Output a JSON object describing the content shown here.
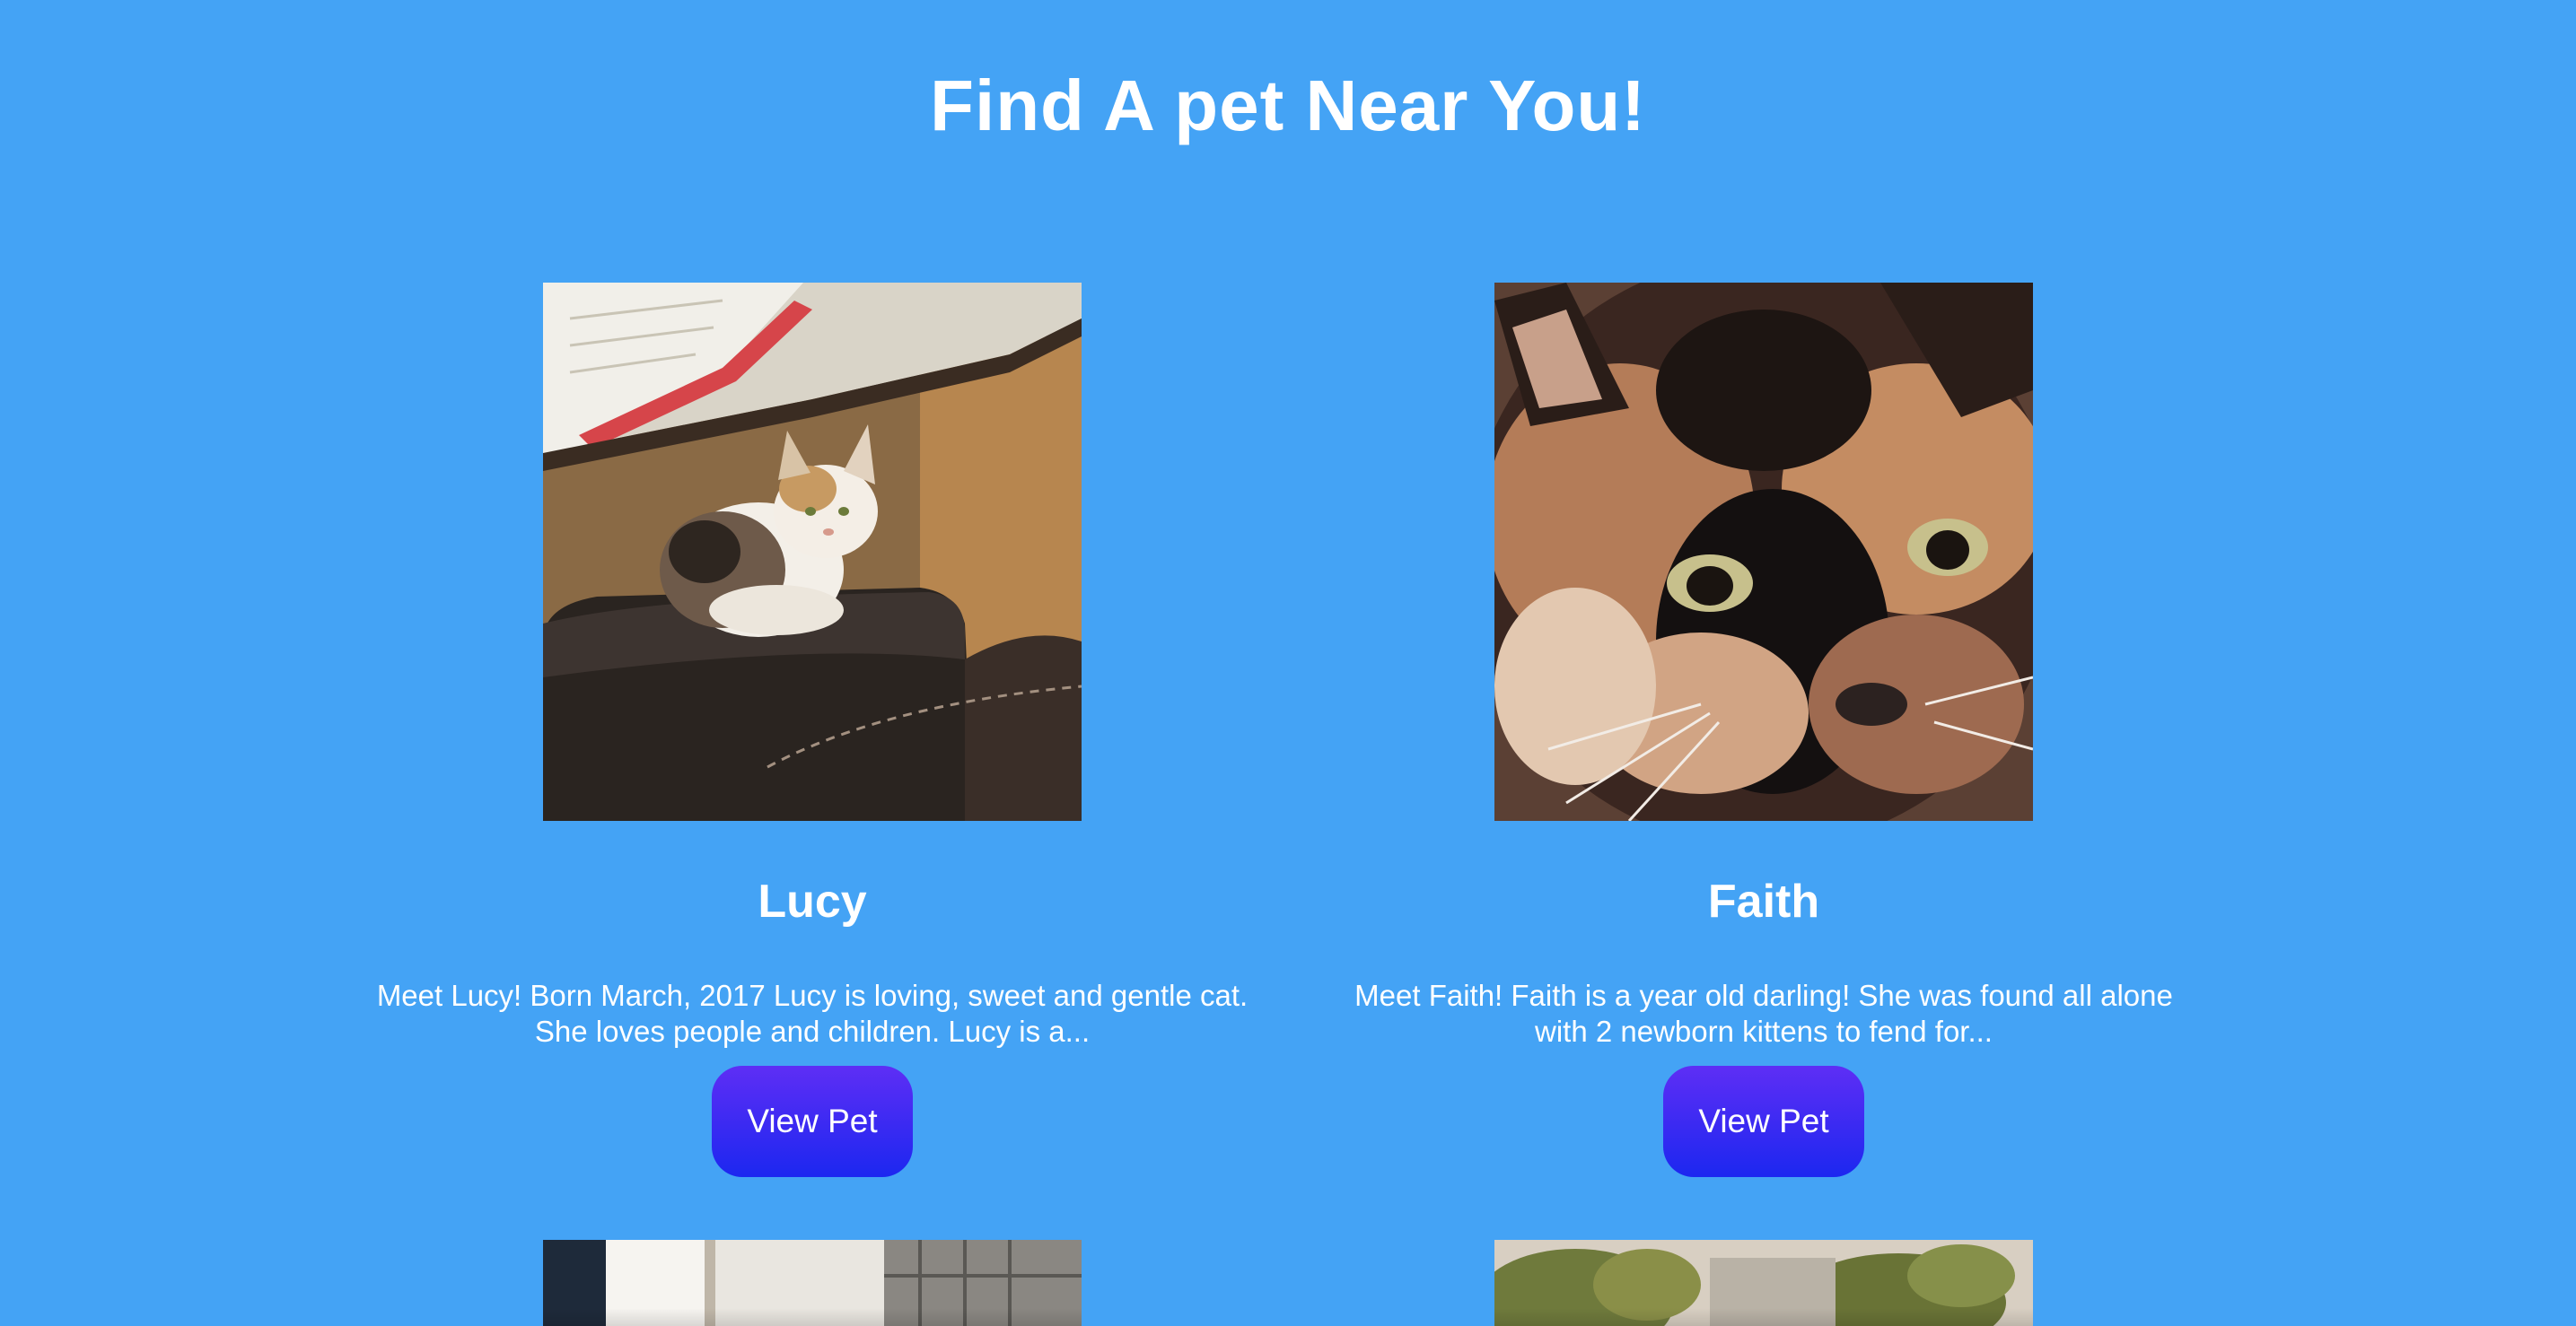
{
  "page": {
    "title": "Find A pet Near You!"
  },
  "pets": [
    {
      "name": "Lucy",
      "description_line1": "Meet Lucy! Born March, 2017 Lucy is loving, sweet and gentle cat.",
      "description_line2": "She loves people and children. Lucy is a...",
      "button_label": "View Pet",
      "photo_icon": "calico-kitten-photo"
    },
    {
      "name": "Faith",
      "description_line1": "Meet Faith! Faith is a year old darling! She was found all alone",
      "description_line2": "with 2 newborn kittens to fend for...",
      "button_label": "View Pet",
      "photo_icon": "tortoiseshell-cat-photo"
    }
  ],
  "colors": {
    "background": "#44a3f5",
    "button_top": "#5e2ef5",
    "button_bottom": "#1c27f0",
    "text": "#ffffff"
  }
}
